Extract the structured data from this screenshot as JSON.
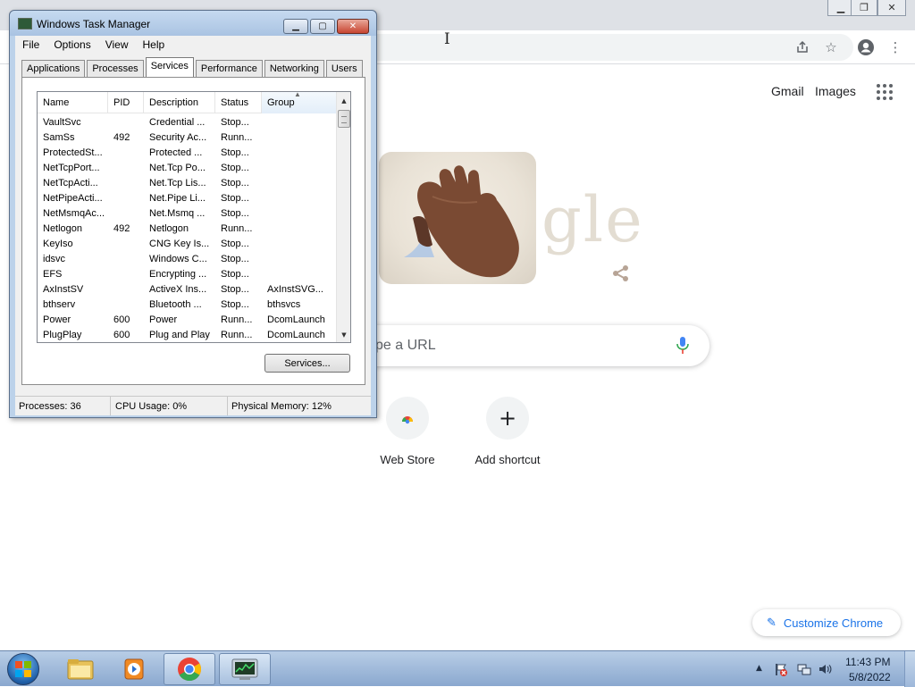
{
  "chrome": {
    "top_links": {
      "gmail": "Gmail",
      "images": "Images"
    },
    "doodle_letters": "gle",
    "search_placeholder": "pe a URL",
    "shortcuts": [
      {
        "label": "Web Store",
        "icon": "chrome-webstore-icon"
      },
      {
        "label": "Add shortcut",
        "icon": "plus-icon",
        "symbol": "+"
      }
    ],
    "customize_label": "Customize Chrome",
    "colors": {
      "accent": "#1a73e8",
      "mic_blue": "#4285f4",
      "mic_red": "#ea4335"
    }
  },
  "task_manager": {
    "title": "Windows Task Manager",
    "menu": [
      "File",
      "Options",
      "View",
      "Help"
    ],
    "tabs": [
      "Applications",
      "Processes",
      "Services",
      "Performance",
      "Networking",
      "Users"
    ],
    "active_tab": "Services",
    "columns": [
      "Name",
      "PID",
      "Description",
      "Status",
      "Group"
    ],
    "sorted_column": "Group",
    "services": [
      {
        "name": "VaultSvc",
        "pid": "",
        "description": "Credential ...",
        "status": "Stop...",
        "group": ""
      },
      {
        "name": "SamSs",
        "pid": "492",
        "description": "Security Ac...",
        "status": "Runn...",
        "group": ""
      },
      {
        "name": "ProtectedSt...",
        "pid": "",
        "description": "Protected ...",
        "status": "Stop...",
        "group": ""
      },
      {
        "name": "NetTcpPort...",
        "pid": "",
        "description": "Net.Tcp Po...",
        "status": "Stop...",
        "group": ""
      },
      {
        "name": "NetTcpActi...",
        "pid": "",
        "description": "Net.Tcp Lis...",
        "status": "Stop...",
        "group": ""
      },
      {
        "name": "NetPipeActi...",
        "pid": "",
        "description": "Net.Pipe Li...",
        "status": "Stop...",
        "group": ""
      },
      {
        "name": "NetMsmqAc...",
        "pid": "",
        "description": "Net.Msmq ...",
        "status": "Stop...",
        "group": ""
      },
      {
        "name": "Netlogon",
        "pid": "492",
        "description": "Netlogon",
        "status": "Runn...",
        "group": ""
      },
      {
        "name": "KeyIso",
        "pid": "",
        "description": "CNG Key Is...",
        "status": "Stop...",
        "group": ""
      },
      {
        "name": "idsvc",
        "pid": "",
        "description": "Windows C...",
        "status": "Stop...",
        "group": ""
      },
      {
        "name": "EFS",
        "pid": "",
        "description": "Encrypting ...",
        "status": "Stop...",
        "group": ""
      },
      {
        "name": "AxInstSV",
        "pid": "",
        "description": "ActiveX Ins...",
        "status": "Stop...",
        "group": "AxInstSVG..."
      },
      {
        "name": "bthserv",
        "pid": "",
        "description": "Bluetooth ...",
        "status": "Stop...",
        "group": "bthsvcs"
      },
      {
        "name": "Power",
        "pid": "600",
        "description": "Power",
        "status": "Runn...",
        "group": "DcomLaunch"
      },
      {
        "name": "PlugPlay",
        "pid": "600",
        "description": "Plug and Play",
        "status": "Runn...",
        "group": "DcomLaunch"
      }
    ],
    "services_button": "Services...",
    "status": {
      "processes": "Processes: 36",
      "cpu": "CPU Usage: 0%",
      "memory": "Physical Memory: 12%"
    }
  },
  "taskbar": {
    "pinned": [
      "windows-explorer-icon",
      "media-player-icon",
      "chrome-icon",
      "task-manager-icon"
    ],
    "active": "task-manager-icon",
    "clock": {
      "time": "11:43 PM",
      "date": "5/8/2022"
    }
  }
}
